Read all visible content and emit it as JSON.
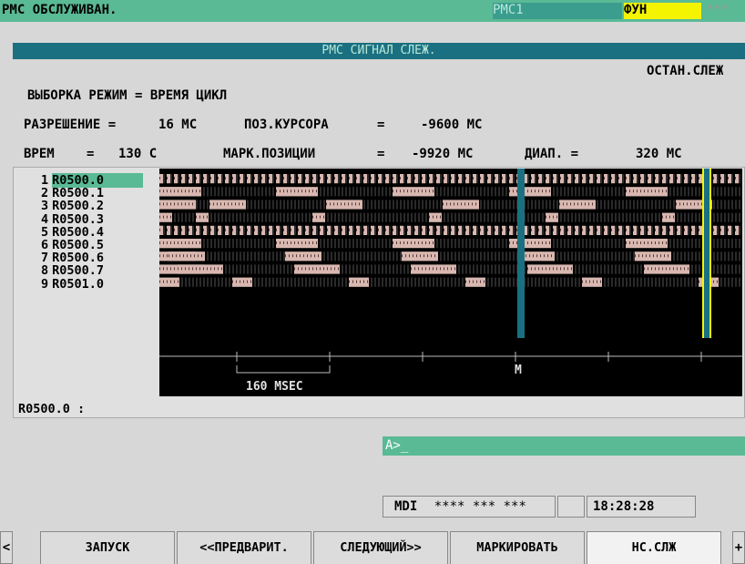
{
  "top": {
    "screen_title": "РМС ОБСЛУЖИВАН.",
    "status1": "РМС1",
    "status2": "ФУН",
    "status3": "***",
    "colors": {
      "bar": "#5aba96",
      "status2_bg": "#f4f400"
    }
  },
  "header": {
    "title": "РМС СИГНАЛ СЛЕЖ."
  },
  "state": "ОСТАН.СЛЕЖ",
  "sampling_mode": "ВЫБОРКА РЕЖИМ = ВРЕМЯ ЦИКЛ",
  "resolution": {
    "label": "РАЗРЕШЕНИЕ =",
    "value": "16 МС"
  },
  "cursor_pos": {
    "label": "ПОЗ.КУРСОРА",
    "eq": "=",
    "value": "-9600 МС"
  },
  "time": {
    "label": "ВРЕМ",
    "eq": "=",
    "value": "130 С"
  },
  "mark_pos": {
    "label": "МАРК.ПОЗИЦИИ",
    "eq": "=",
    "value": "-9920 МС"
  },
  "range": {
    "label": "ДИАП. =",
    "value": "320 МС"
  },
  "channels": [
    {
      "num": "1",
      "addr": "R0500.0"
    },
    {
      "num": "2",
      "addr": "R0500.1"
    },
    {
      "num": "3",
      "addr": "R0500.2"
    },
    {
      "num": "4",
      "addr": "R0500.3"
    },
    {
      "num": "5",
      "addr": "R0500.4"
    },
    {
      "num": "6",
      "addr": "R0500.5"
    },
    {
      "num": "7",
      "addr": "R0500.6"
    },
    {
      "num": "8",
      "addr": "R0500.7"
    },
    {
      "num": "9",
      "addr": "R0501.0"
    }
  ],
  "scale": {
    "label": "160 MSEC",
    "mark": "M"
  },
  "selected_signal": "R0500.0 :",
  "command": {
    "prompt": "A>_"
  },
  "status": {
    "mode": "MDI",
    "stars": "**** *** ***",
    "time": "18:28:28"
  },
  "softkeys": {
    "left": "<",
    "right": "+",
    "items": [
      "ЗАПУСК",
      "<<ПРЕДВАРИТ.",
      "СЛЕДУЮЩИЙ>>",
      "МАРКИРОВАТЬ",
      "НС.СЛЖ"
    ]
  }
}
